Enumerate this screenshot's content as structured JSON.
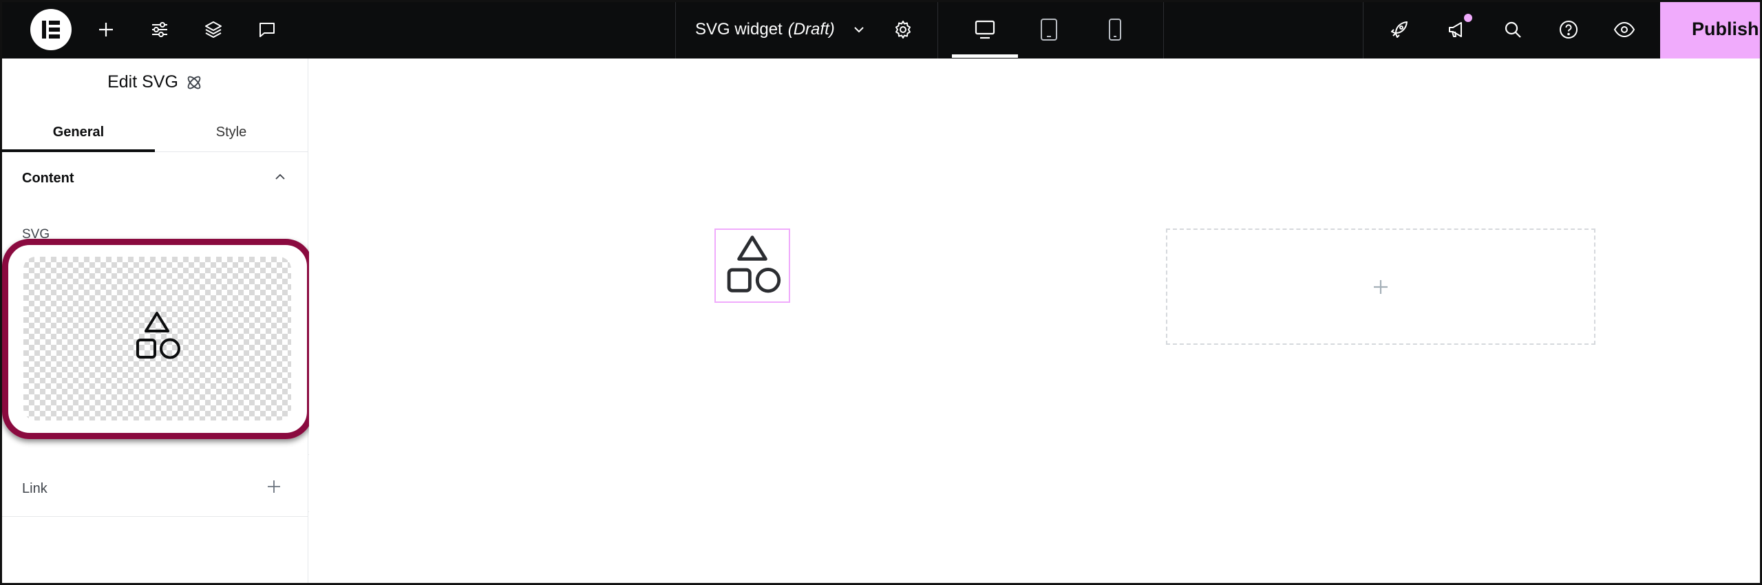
{
  "topbar": {
    "document_title": "SVG widget",
    "document_status": "(Draft)",
    "publish_label": "Publish"
  },
  "panel": {
    "title": "Edit SVG",
    "tabs": [
      {
        "label": "General",
        "active": true
      },
      {
        "label": "Style",
        "active": false
      }
    ],
    "section_title": "Content",
    "svg_label": "SVG",
    "link_label": "Link"
  },
  "colors": {
    "topbar_bg": "#0c0d0e",
    "accent_pink": "#f0abfc",
    "highlight": "#8a0a3f"
  },
  "icons": {
    "add": "plus-icon",
    "site_settings": "sliders-icon",
    "structure": "layers-icon",
    "notes": "comment-icon",
    "settings": "gear-icon",
    "desktop": "desktop-icon",
    "tablet": "tablet-icon",
    "mobile": "mobile-icon",
    "launchpad": "rocket-icon",
    "whats_new": "megaphone-icon",
    "finder": "search-icon",
    "help": "help-icon",
    "preview": "eye-icon"
  }
}
